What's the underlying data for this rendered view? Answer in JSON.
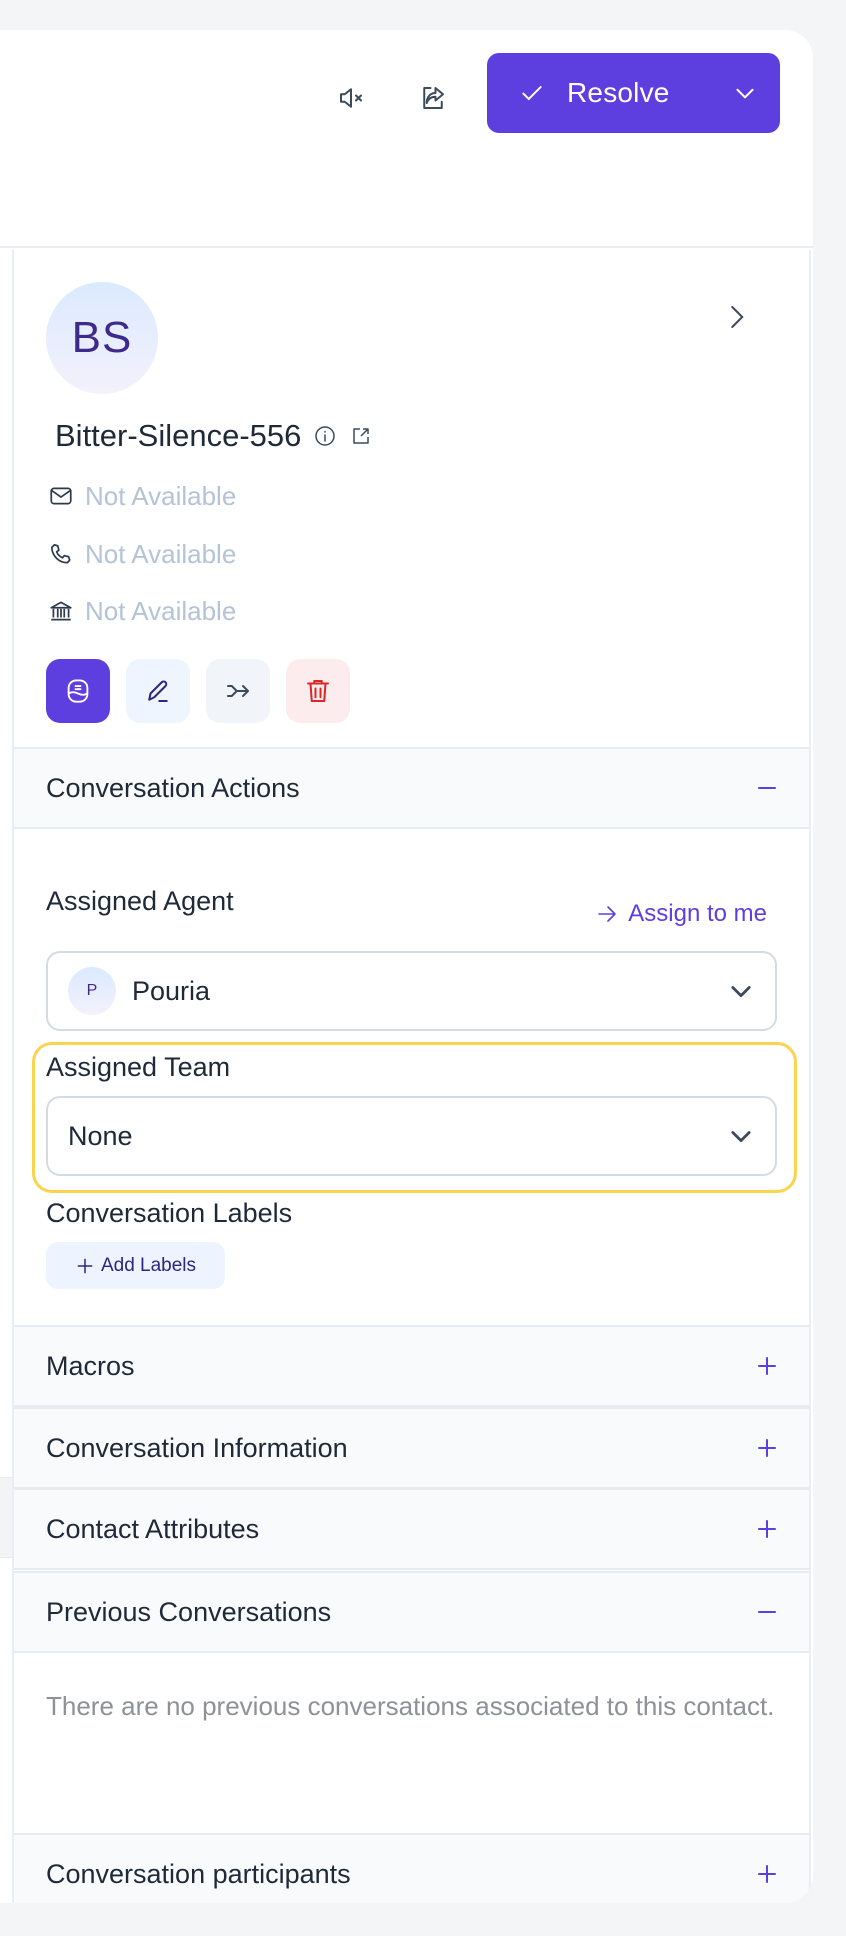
{
  "header": {
    "mute_icon": "mute-icon",
    "share_icon": "share-icon",
    "resolve_label": "Resolve"
  },
  "contact": {
    "initials": "BS",
    "name": "Bitter-Silence-556",
    "email": "Not Available",
    "phone": "Not Available",
    "company": "Not Available",
    "actions": [
      "new-message",
      "edit-contact",
      "merge-contact",
      "delete-contact"
    ]
  },
  "sections": {
    "conversation_actions": {
      "title": "Conversation Actions",
      "expanded": true,
      "assigned_agent_label": "Assigned Agent",
      "assign_to_me_label": "Assign to me",
      "assigned_agent": {
        "initial": "P",
        "name": "Pouria"
      },
      "assigned_team_label": "Assigned Team",
      "assigned_team": "None",
      "labels_label": "Conversation Labels",
      "add_labels_label": "Add Labels"
    },
    "macros": {
      "title": "Macros",
      "expanded": false
    },
    "conversation_information": {
      "title": "Conversation Information",
      "expanded": false
    },
    "contact_attributes": {
      "title": "Contact Attributes",
      "expanded": false
    },
    "previous_conversations": {
      "title": "Previous Conversations",
      "expanded": true,
      "empty_text": "There are no previous conversations associated to this contact."
    },
    "conversation_participants": {
      "title": "Conversation participants",
      "expanded": false
    }
  },
  "colors": {
    "accent": "#5d3fe0",
    "highlight": "#fcd34d",
    "muted_text": "#b4c3d6",
    "danger": "#dc2626"
  }
}
